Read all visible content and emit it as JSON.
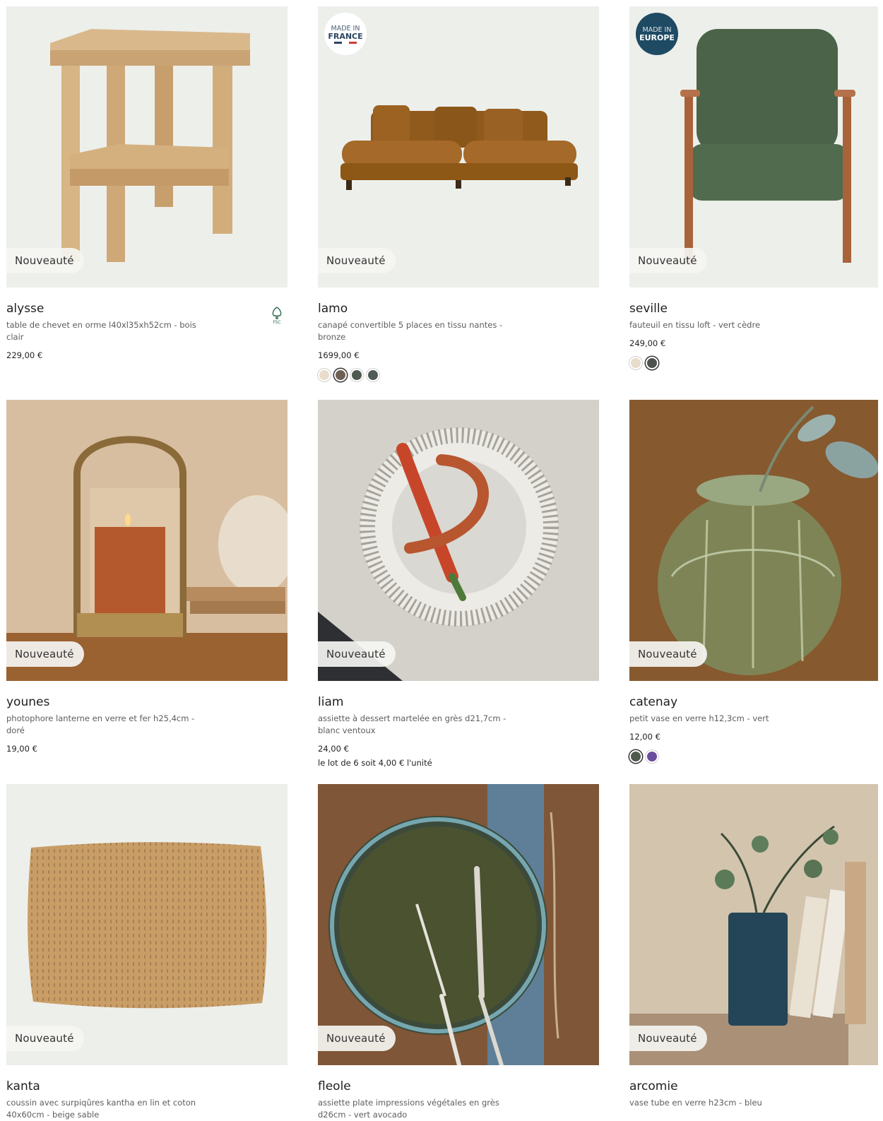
{
  "badge_label": "Nouveauté",
  "products": [
    {
      "name": "alysse",
      "desc": "table de chevet en orme l40xl35xh52cm - bois clair",
      "price": "229,00 €"
    },
    {
      "name": "lamo",
      "desc": "canapé convertible 5 places en tissu nantes - bronze",
      "price": "1699,00 €",
      "origin": {
        "line1": "MADE IN",
        "line2": "FRANCE"
      }
    },
    {
      "name": "seville",
      "desc": "fauteuil en tissu loft - vert cèdre",
      "price": "249,00 €",
      "origin": {
        "line1": "MADE IN",
        "line2": "EUROPE"
      }
    },
    {
      "name": "younes",
      "desc": "photophore lanterne en verre et fer h25,4cm - doré",
      "price": "19,00 €"
    },
    {
      "name": "liam",
      "desc": "assiette à dessert martelée en grès d21,7cm - blanc ventoux",
      "price": "24,00 €",
      "unit_price": "le lot de 6 soit 4,00 € l'unité"
    },
    {
      "name": "catenay",
      "desc": "petit vase en verre h12,3cm - vert",
      "price": "12,00 €"
    },
    {
      "name": "kanta",
      "desc": "coussin avec surpiqûres kantha en lin et coton 40x60cm - beige sable"
    },
    {
      "name": "fleole",
      "desc": "assiette plate impressions végétales en grès d26cm - vert avocado"
    },
    {
      "name": "arcomie",
      "desc": "vase tube en verre h23cm - bleu"
    }
  ],
  "swatches": {
    "lamo": [
      "#e8dccb",
      "#6f6052",
      "#4d5a50",
      "#505a56"
    ],
    "seville": [
      "#e8dccb",
      "#4d524e"
    ],
    "catenay": [
      "#4f5a4f",
      "#6a4c9c"
    ]
  },
  "colors": {
    "image_bg": "#edefeb",
    "badge_bg": "#f5f5f2",
    "eu_badge": "#1e4a63"
  },
  "icons": [
    "fsc-tree-icon",
    "made-in-france-badge",
    "made-in-europe-badge"
  ]
}
